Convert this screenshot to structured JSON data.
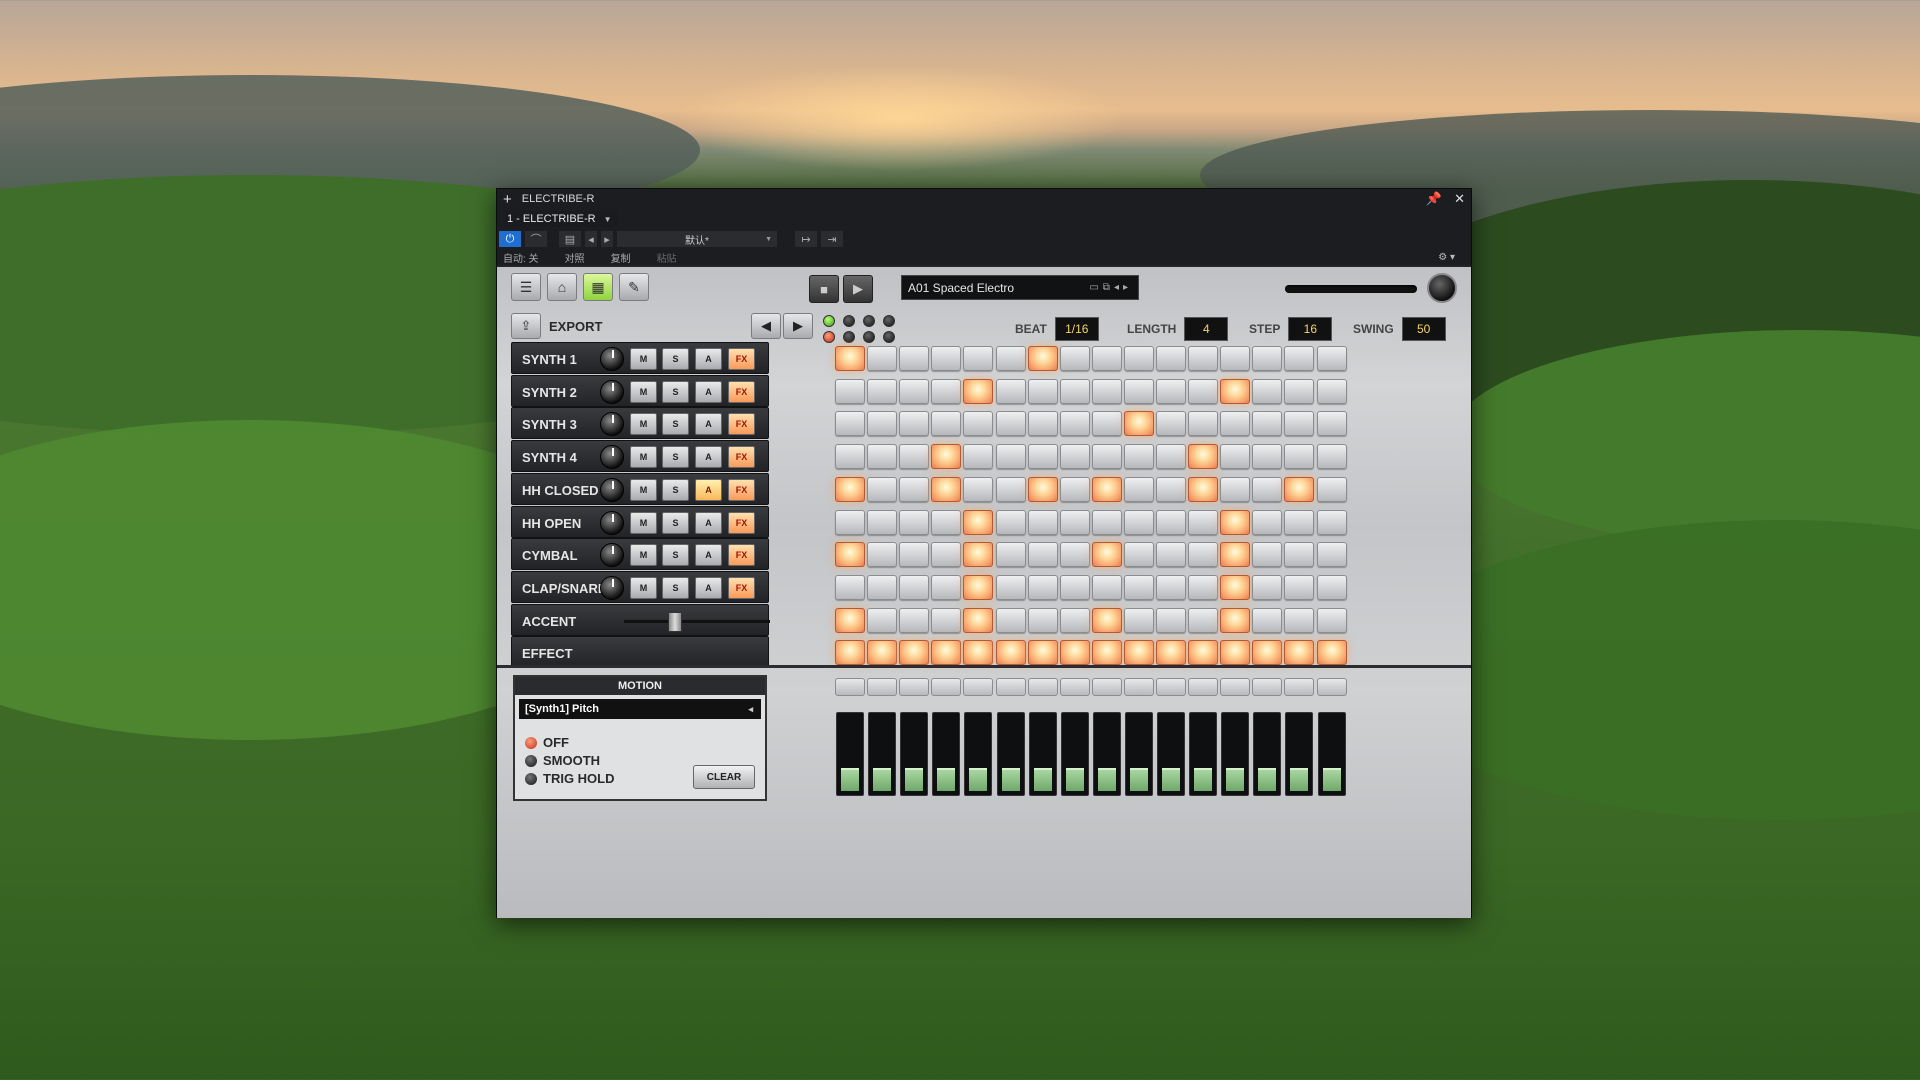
{
  "window": {
    "title": "ELECTRIBE-R",
    "device_selector": "1 - ELECTRIBE-R",
    "preset_dropdown": "默认*",
    "row_labels": [
      "自动: 关",
      "对照",
      "复制",
      "粘贴"
    ]
  },
  "instrument": {
    "preset_name": "A01 Spaced Electro",
    "export_label": "EXPORT",
    "beat": {
      "label": "BEAT",
      "value": "1/16"
    },
    "length": {
      "label": "LENGTH",
      "value": "4"
    },
    "step": {
      "label": "STEP",
      "value": "16"
    },
    "swing": {
      "label": "SWING",
      "value": "50"
    },
    "track_buttons": {
      "m": "M",
      "s": "S",
      "a": "A",
      "fx": "FX"
    },
    "tracks": [
      {
        "name": "SYNTH 1",
        "accent_lit": false,
        "steps": [
          1,
          0,
          0,
          0,
          0,
          0,
          1,
          0,
          0,
          0,
          0,
          0,
          0,
          0,
          0,
          0
        ]
      },
      {
        "name": "SYNTH 2",
        "accent_lit": false,
        "steps": [
          0,
          0,
          0,
          0,
          1,
          0,
          0,
          0,
          0,
          0,
          0,
          0,
          1,
          0,
          0,
          0
        ]
      },
      {
        "name": "SYNTH 3",
        "accent_lit": false,
        "steps": [
          0,
          0,
          0,
          0,
          0,
          0,
          0,
          0,
          0,
          1,
          0,
          0,
          0,
          0,
          0,
          0
        ]
      },
      {
        "name": "SYNTH 4",
        "accent_lit": false,
        "steps": [
          0,
          0,
          0,
          1,
          0,
          0,
          0,
          0,
          0,
          0,
          0,
          1,
          0,
          0,
          0,
          0
        ]
      },
      {
        "name": "HH CLOSED",
        "accent_lit": true,
        "steps": [
          1,
          0,
          0,
          1,
          0,
          0,
          1,
          0,
          1,
          0,
          0,
          1,
          0,
          0,
          1,
          0
        ]
      },
      {
        "name": "HH OPEN",
        "accent_lit": false,
        "steps": [
          0,
          0,
          0,
          0,
          1,
          0,
          0,
          0,
          0,
          0,
          0,
          0,
          1,
          0,
          0,
          0
        ]
      },
      {
        "name": "CYMBAL",
        "accent_lit": false,
        "steps": [
          1,
          0,
          0,
          0,
          1,
          0,
          0,
          0,
          1,
          0,
          0,
          0,
          1,
          0,
          0,
          0
        ]
      },
      {
        "name": "CLAP/SNARE",
        "accent_lit": false,
        "steps": [
          0,
          0,
          0,
          0,
          1,
          0,
          0,
          0,
          0,
          0,
          0,
          0,
          1,
          0,
          0,
          0
        ]
      }
    ],
    "accent": {
      "name": "ACCENT",
      "level": 0.33,
      "steps": [
        1,
        0,
        0,
        0,
        1,
        0,
        0,
        0,
        1,
        0,
        0,
        0,
        1,
        0,
        0,
        0
      ]
    },
    "effect": {
      "name": "EFFECT",
      "steps": [
        1,
        1,
        1,
        1,
        1,
        1,
        1,
        1,
        1,
        1,
        1,
        1,
        1,
        1,
        1,
        1
      ]
    },
    "motion": {
      "title": "MOTION",
      "target": "[Synth1] Pitch",
      "options": [
        "OFF",
        "SMOOTH",
        "TRIG HOLD"
      ],
      "selected": "OFF",
      "clear_label": "CLEAR",
      "fader_levels": [
        0.3,
        0.3,
        0.3,
        0.3,
        0.3,
        0.3,
        0.3,
        0.3,
        0.3,
        0.3,
        0.3,
        0.3,
        0.3,
        0.3,
        0.3,
        0.3
      ]
    },
    "colors": {
      "pad_on": "#f7a06a",
      "accent_green": "#8fd43e",
      "display_text": "#f3d36a"
    }
  }
}
